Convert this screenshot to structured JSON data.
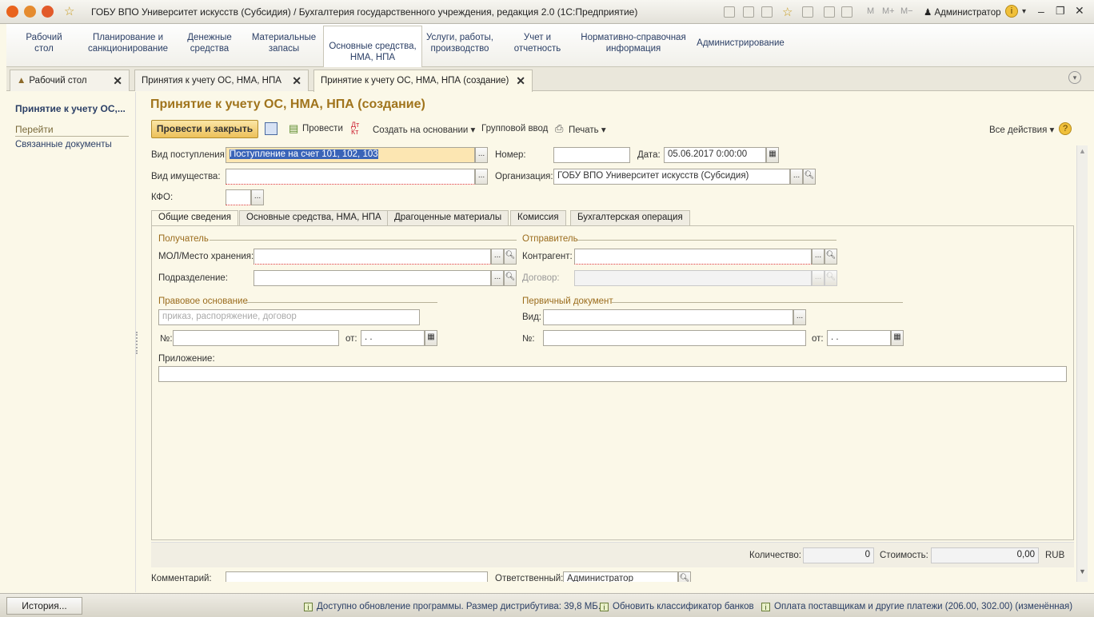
{
  "titlebar": {
    "title": "ГОБУ ВПО Университет искусств (Субсидия) / Бухгалтерия государственного учреждения, редакция 2.0  (1С:Предприятие)",
    "m_label": "M",
    "mplus_label": "M+",
    "mminus_label": "M−",
    "user": "Администратор"
  },
  "sections": [
    {
      "label": "Рабочий\nстол"
    },
    {
      "label": "Планирование и\nсанкционирование"
    },
    {
      "label": "Денежные\nсредства"
    },
    {
      "label": "Материальные\nзапасы"
    },
    {
      "label": "Основные средства,\nНМА, НПА"
    },
    {
      "label": "Услуги, работы,\nпроизводство"
    },
    {
      "label": "Учет и\nотчетность"
    },
    {
      "label": "Нормативно-справочная\nинформация"
    },
    {
      "label": "Администрирование"
    }
  ],
  "window_tabs": [
    {
      "label": "Рабочий стол"
    },
    {
      "label": "Принятия к учету ОС, НМА, НПА"
    },
    {
      "label": "Принятие к учету ОС, НМА, НПА (создание)"
    }
  ],
  "left_panel": {
    "title": "Принятие к учету ОС,...",
    "goto": "Перейти",
    "related": "Связанные документы"
  },
  "form": {
    "title": "Принятие к учету ОС, НМА, НПА (создание)",
    "toolbar": {
      "post_close": "Провести и закрыть",
      "post": "Провести",
      "create_based": "Создать на основании",
      "group_input": "Групповой ввод",
      "print": "Печать",
      "all_actions": "Все действия"
    },
    "vid_postupleniya_label": "Вид поступления:",
    "vid_postupleniya_value": "Поступление на счет 101, 102, 103",
    "nomer_label": "Номер:",
    "nomer_value": "",
    "data_label": "Дата:",
    "data_value": "05.06.2017  0:00:00",
    "vid_imushchestva_label": "Вид имущества:",
    "vid_imushchestva_value": "",
    "organizaciya_label": "Организация:",
    "organizaciya_value": "ГОБУ ВПО Университет искусств (Субсидия)",
    "kfo_label": "КФО:",
    "kfo_value": "",
    "tabs": [
      "Общие сведения",
      "Основные средства, НМА, НПА",
      "Драгоценные материалы",
      "Комиссия",
      "Бухгалтерская операция"
    ],
    "poluchatel": {
      "header": "Получатель",
      "mol_label": "МОЛ/Место хранения:",
      "mol_value": "",
      "podrazdelenie_label": "Подразделение:",
      "podrazdelenie_value": ""
    },
    "otpravitel": {
      "header": "Отправитель",
      "kontragent_label": "Контрагент:",
      "kontragent_value": "",
      "dogovor_label": "Договор:",
      "dogovor_value": ""
    },
    "pravovoe": {
      "header": "Правовое основание",
      "placeholder": "приказ, распоряжение, договор",
      "num_label": "№:",
      "num_value": "",
      "ot_label": "от:",
      "ot_value": " .  ."
    },
    "pervichnyi": {
      "header": "Первичный документ",
      "vid_label": "Вид:",
      "vid_value": "",
      "num_label": "№:",
      "num_value": "",
      "ot_label": "от:",
      "ot_value": " .  ."
    },
    "prilozhenie_label": "Приложение:",
    "prilozhenie_value": "",
    "kolichestvo_label": "Количество:",
    "kolichestvo_value": "0",
    "stoimost_label": "Стоимость:",
    "stoimost_value": "0,00",
    "currency": "RUB",
    "kommentariy_label": "Комментарий:",
    "otvetstvennyi_label": "Ответственный:",
    "otvetstvennyi_value": "Администратор"
  },
  "statusbar": {
    "history": "История...",
    "msg1": "Доступно обновление программы. Размер дистрибутива: 39,8 МБ.",
    "msg2": "Обновить классификатор банков",
    "msg3": "Оплата поставщикам и другие платежи (206.00, 302.00) (изменённая)"
  }
}
